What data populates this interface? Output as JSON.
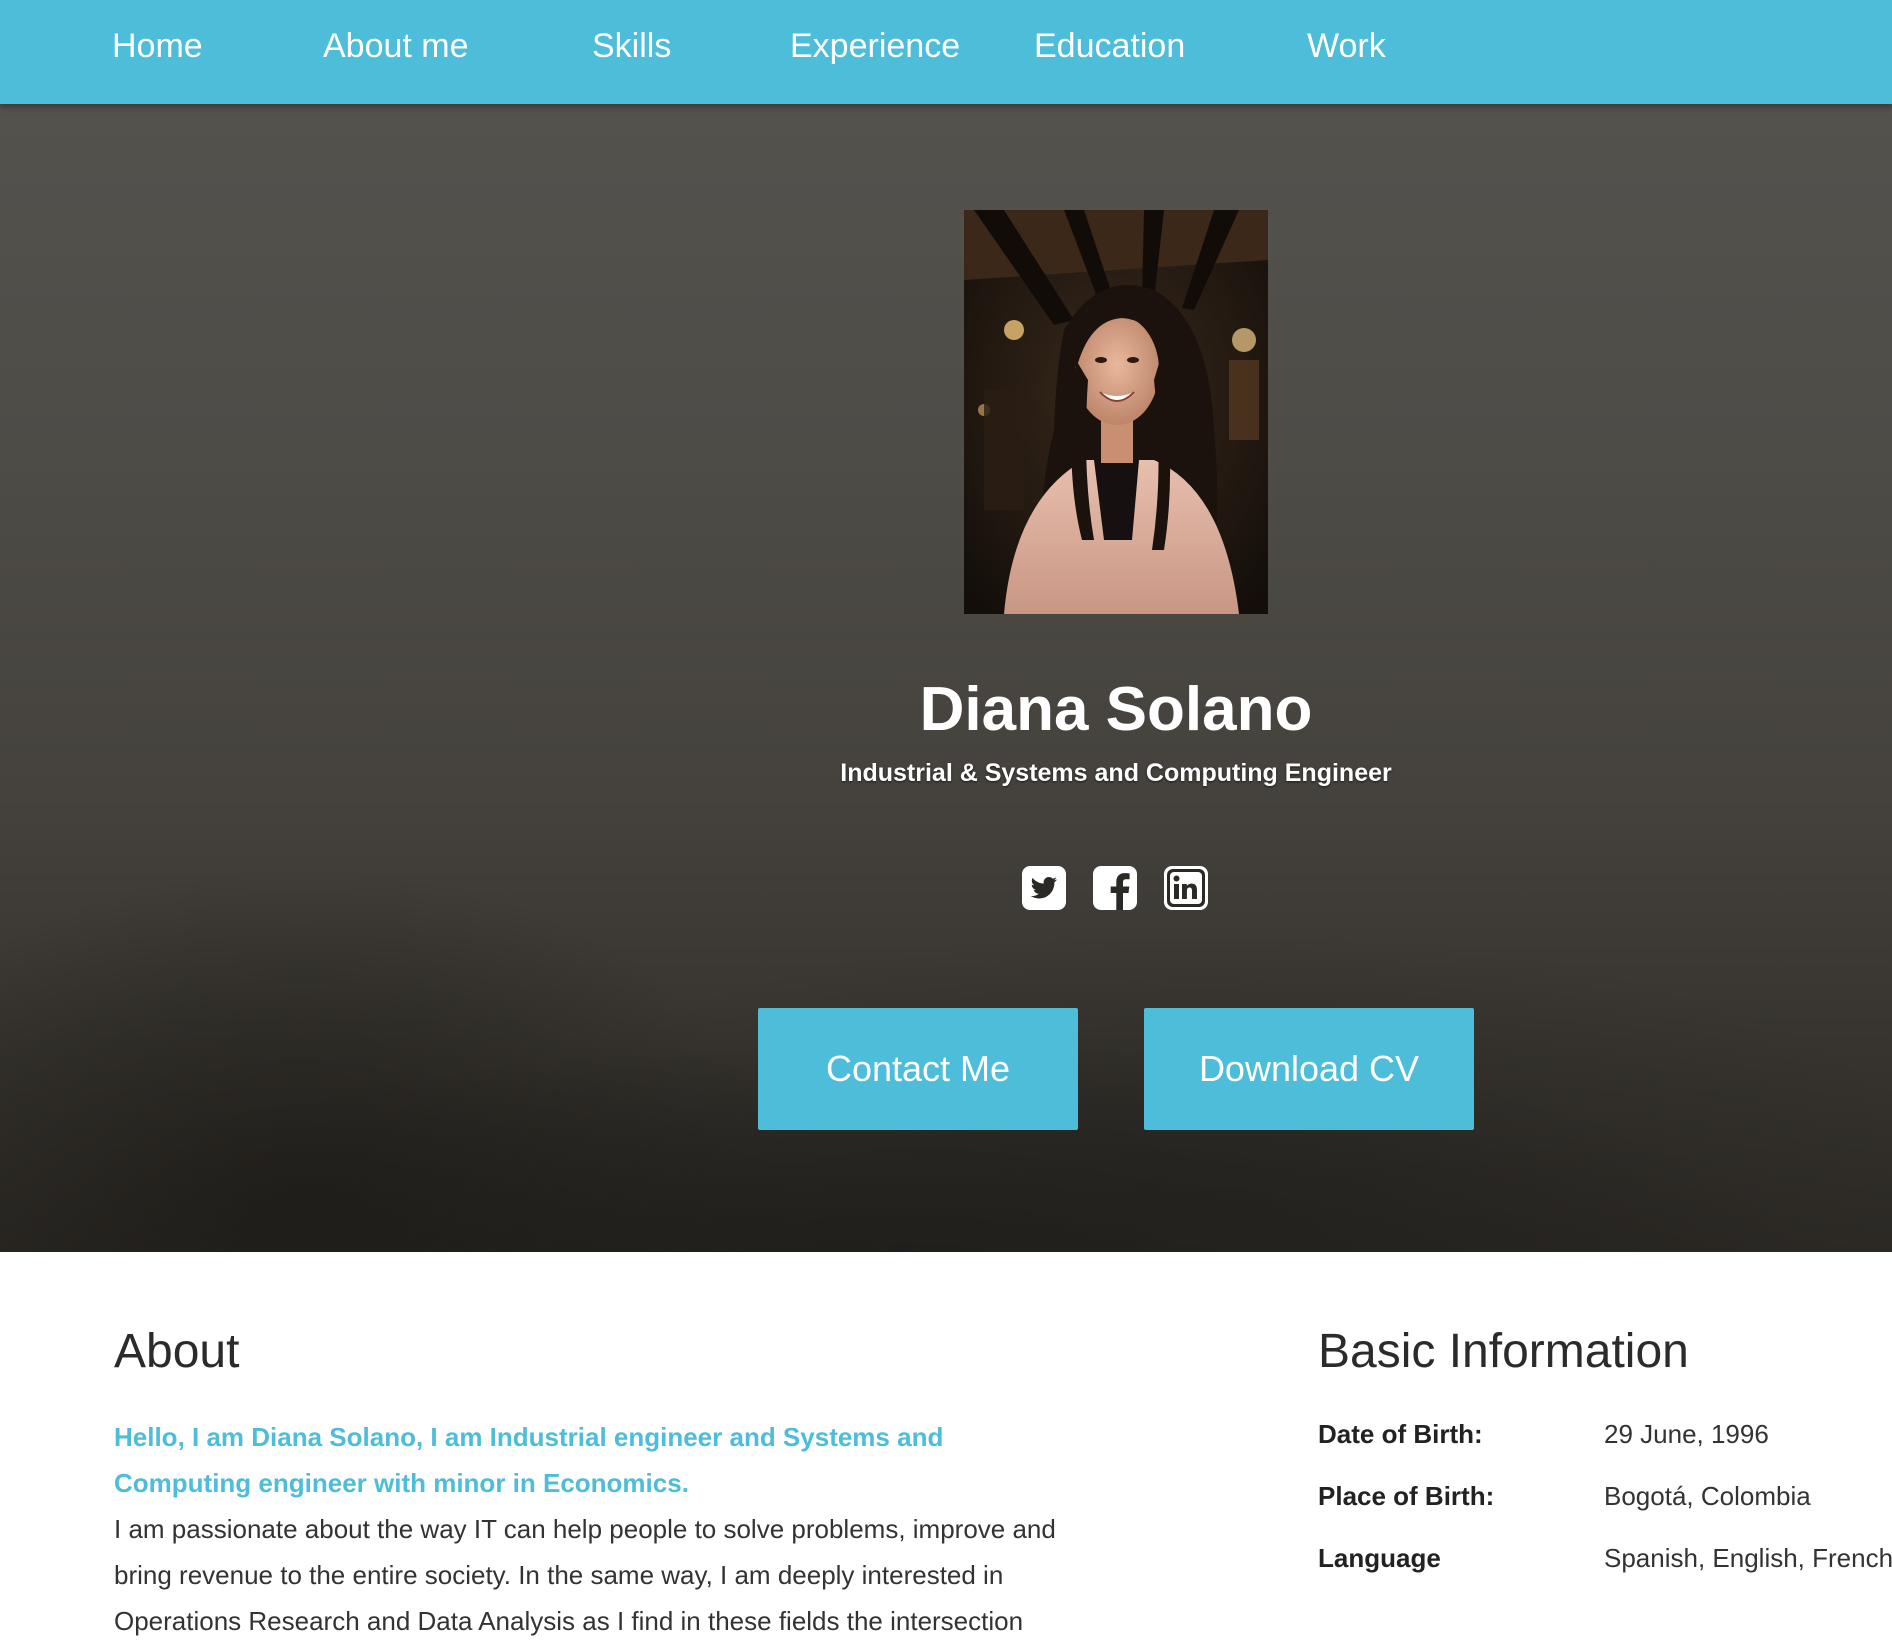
{
  "nav": {
    "items": [
      {
        "label": "Home"
      },
      {
        "label": "About me"
      },
      {
        "label": "Skills"
      },
      {
        "label": "Experience"
      },
      {
        "label": "Education"
      },
      {
        "label": "Work"
      }
    ]
  },
  "hero": {
    "name": "Diana Solano",
    "subtitle": "Industrial & Systems and Computing Engineer",
    "social": [
      "twitter-icon",
      "facebook-icon",
      "linkedin-icon"
    ],
    "buttons": {
      "contact": "Contact Me",
      "download": "Download CV"
    }
  },
  "about": {
    "heading": "About",
    "intro": "Hello, I am Diana Solano, I am Industrial engineer and Systems and Computing engineer with minor in Economics.",
    "body": "I am passionate about the way IT can help people to solve problems, improve and bring revenue to the entire society. In the same way, I am deeply interested in Operations Research and Data Analysis as I find in these fields the intersection"
  },
  "basic_info": {
    "heading": "Basic Information",
    "rows": [
      {
        "label": "Date of Birth:",
        "value": "29 June, 1996"
      },
      {
        "label": "Place of Birth:",
        "value": "Bogotá, Colombia"
      },
      {
        "label": "Language",
        "value": "Spanish, English, French"
      }
    ]
  },
  "colors": {
    "accent": "#4dbdd9",
    "hero_bg": "#4e4c47",
    "text": "#333333"
  }
}
